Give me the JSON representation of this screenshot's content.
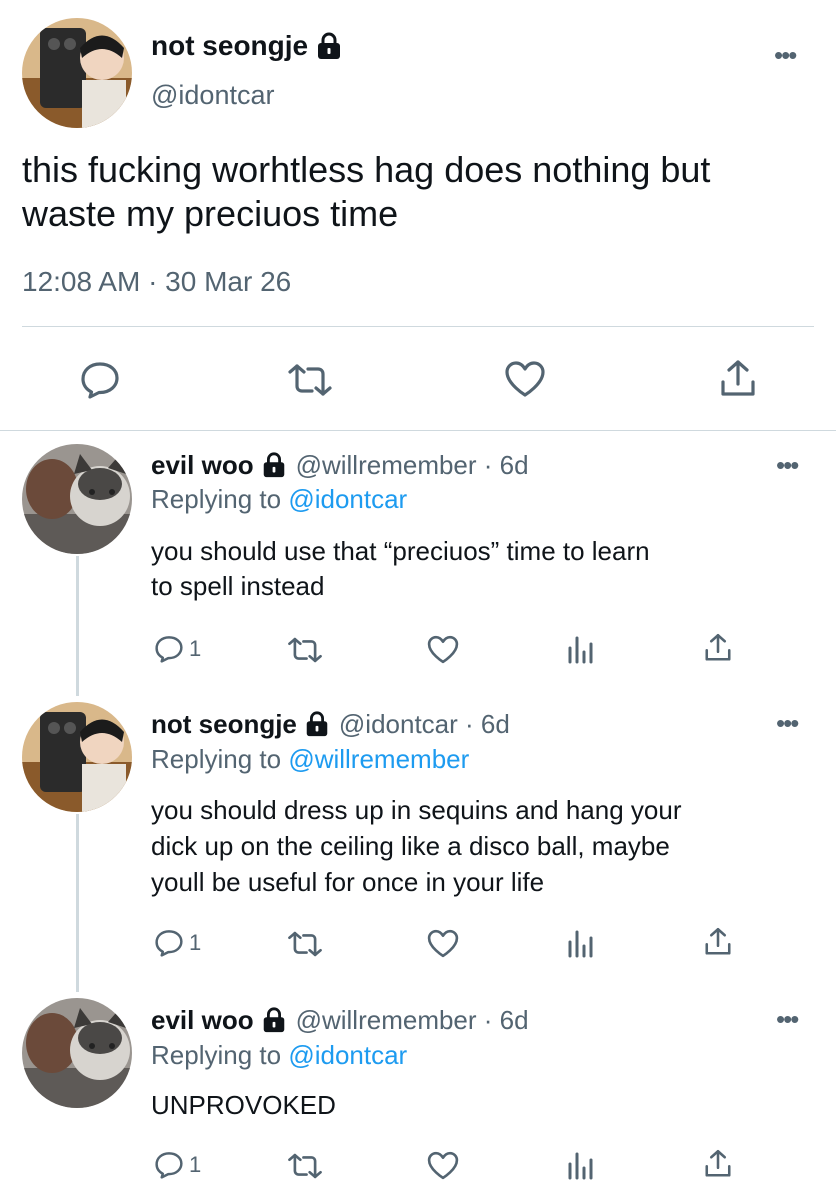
{
  "main_tweet": {
    "display_name": "not seongje",
    "handle": "@idontcar",
    "text_line1": "this fucking worhtless hag does nothing but",
    "text_line2": "waste my preciuos time",
    "timestamp": "12:08 AM · 30 Mar 26",
    "more_label": "•••"
  },
  "replies": [
    {
      "display_name": "evil woo",
      "meta": "@willremember · 6d",
      "replying_prefix": "Replying to ",
      "replying_to": "@idontcar",
      "lines": [
        "you should use that “preciuos” time to learn",
        "to spell instead"
      ],
      "reply_count": "1",
      "more_label": "•••"
    },
    {
      "display_name": "not seongje",
      "meta": "@idontcar · 6d",
      "replying_prefix": "Replying to ",
      "replying_to": "@willremember",
      "lines": [
        "you should dress up in sequins and hang your",
        "dick up on the ceiling like a disco ball, maybe",
        "youll be useful for once in your life"
      ],
      "reply_count": "1",
      "more_label": "•••"
    },
    {
      "display_name": "evil woo",
      "meta": "@willremember · 6d",
      "replying_prefix": "Replying to ",
      "replying_to": "@idontcar",
      "lines": [
        "UNPROVOKED"
      ],
      "reply_count": "1",
      "more_label": "•••"
    }
  ],
  "colors": {
    "accent": "#1d9bf0",
    "text": "#0f1419",
    "muted": "#536471",
    "divider": "#cfd9de"
  }
}
